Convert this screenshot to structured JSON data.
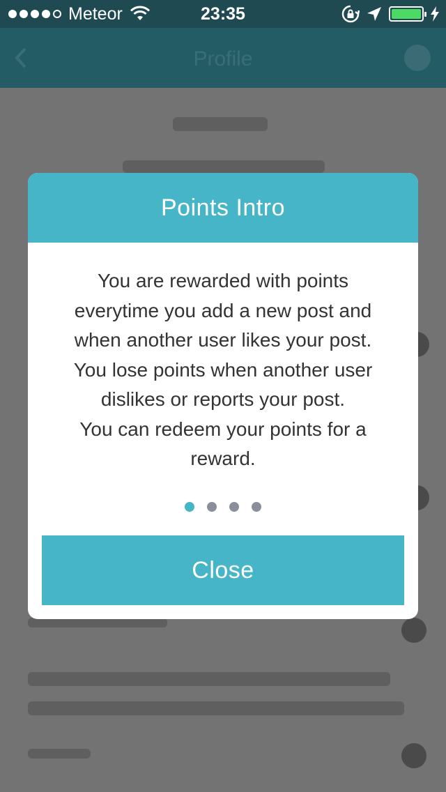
{
  "status_bar": {
    "carrier": "Meteor",
    "time": "23:35",
    "signal_bars_filled": 4,
    "signal_bars_total": 5,
    "battery_level": 1.0
  },
  "nav": {
    "title": "Profile"
  },
  "modal": {
    "title": "Points Intro",
    "body_lines": [
      "You are rewarded with points",
      "everytime you add a new post and",
      "when another user likes your post.",
      "You lose points when another user",
      "dislikes or reports your post.",
      "You can redeem your points for a",
      "reward."
    ],
    "page_count": 4,
    "active_page": 1,
    "close_label": "Close"
  },
  "colors": {
    "accent": "#46b5c7",
    "status_bar": "#1f4a52",
    "battery": "#4cd964",
    "overlay": "#6e6e6e"
  },
  "icons": [
    "wifi-icon",
    "orientation-lock-icon",
    "location-arrow-icon",
    "battery-icon",
    "charging-bolt-icon",
    "back-icon"
  ]
}
